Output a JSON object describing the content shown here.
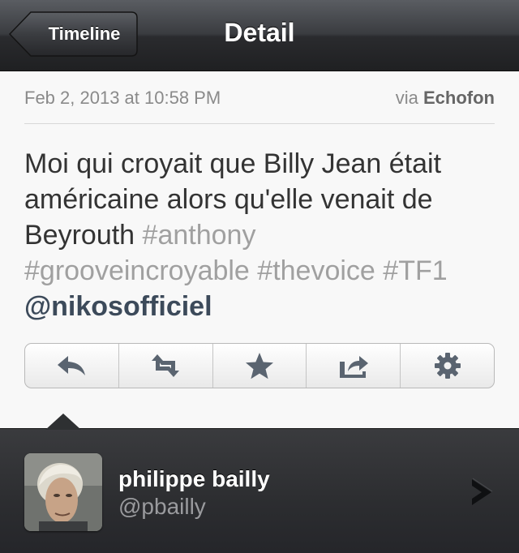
{
  "navbar": {
    "title": "Detail",
    "back_label": "Timeline"
  },
  "tweet": {
    "date": "Feb 2, 2013 at 10:58 PM",
    "via_prefix": "via",
    "via_app": "Echofon",
    "text_plain": "Moi qui croyait que Billy Jean était américaine alors qu'elle venait de Beyrouth",
    "hashtags": [
      "#anthony",
      "#grooveincroyable",
      "#thevoice",
      "#TF1"
    ],
    "mention": "@nikosofficiel"
  },
  "actions": [
    {
      "icon": "reply-icon"
    },
    {
      "icon": "retweet-icon"
    },
    {
      "icon": "star-icon"
    },
    {
      "icon": "share-icon"
    },
    {
      "icon": "gear-icon"
    }
  ],
  "profile": {
    "name": "philippe bailly",
    "handle": "@pbailly"
  },
  "colors": {
    "navbar_dark": "#1f2022",
    "hashtag": "#a0a0a0",
    "mention": "#3c4a5a",
    "icon": "#5a6470"
  }
}
